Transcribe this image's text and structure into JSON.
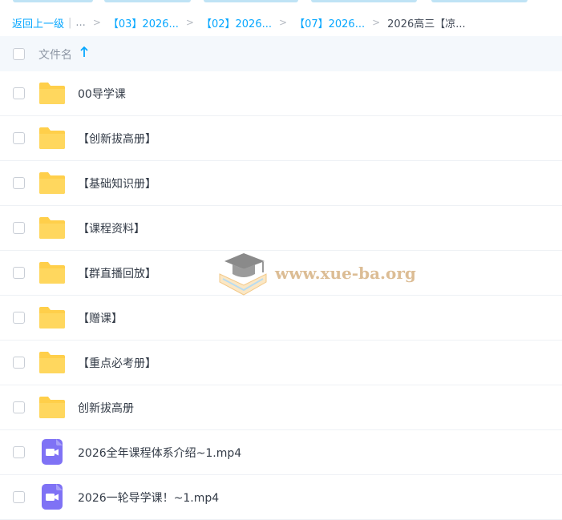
{
  "breadcrumb": {
    "back_label": "返回上一级",
    "separator_bar": "|",
    "collapsed": "...",
    "items": [
      {
        "label": "【03】2026..."
      },
      {
        "label": "【02】2026..."
      },
      {
        "label": "【07】2026..."
      }
    ],
    "current": "2026高三【凉..."
  },
  "table": {
    "header_label": "文件名",
    "sort_direction": "ascending"
  },
  "files": [
    {
      "name": "00导学课",
      "type": "folder"
    },
    {
      "name": "【创新拔高册】",
      "type": "folder"
    },
    {
      "name": "【基础知识册】",
      "type": "folder"
    },
    {
      "name": "【课程资料】",
      "type": "folder"
    },
    {
      "name": "【群直播回放】",
      "type": "folder"
    },
    {
      "name": "【赠课】",
      "type": "folder"
    },
    {
      "name": "【重点必考册】",
      "type": "folder"
    },
    {
      "name": "创新拔高册",
      "type": "folder"
    },
    {
      "name": "2026全年课程体系介绍~1.mp4",
      "type": "video"
    },
    {
      "name": "2026一轮导学课！~1.mp4",
      "type": "video"
    }
  ],
  "watermark": {
    "text": "www.xue-ba.org"
  },
  "colors": {
    "accent": "#06a7ff",
    "folder": "#ffcf4a",
    "video": "#7f72f5",
    "header_bg": "#f4f8fc"
  }
}
